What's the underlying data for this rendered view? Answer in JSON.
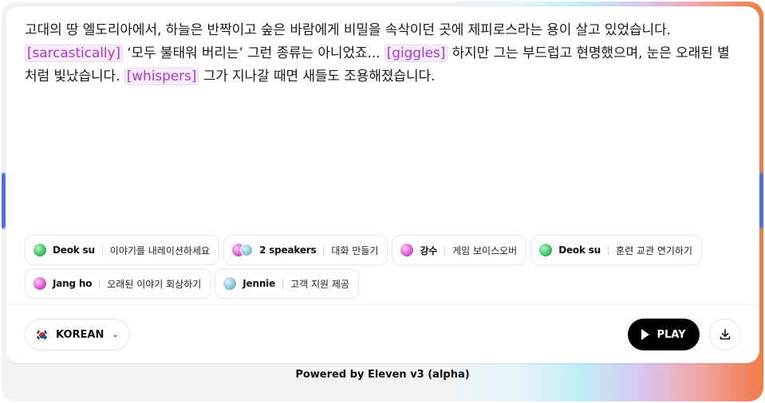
{
  "editor": {
    "segments": [
      {
        "type": "text",
        "value": "고대의 땅 엘도리아에서, 하늘은 반짝이고 숲은 바람에게 비밀을 속삭이던 곳에 제피로스라는 용이 살고 있었습니다. "
      },
      {
        "type": "tag",
        "value": "[sarcastically]"
      },
      {
        "type": "text",
        "value": " ‘모두 불태워 버리는’ 그런 종류는 아니었죠... "
      },
      {
        "type": "tag",
        "value": "[giggles]"
      },
      {
        "type": "text",
        "value": " 하지만 그는 부드럽고 현명했으며, 눈은 오래된 별처럼 빛났습니다. "
      },
      {
        "type": "tag",
        "value": "[whispers]"
      },
      {
        "type": "text",
        "value": " 그가 지나갈 때면 새들도 조용해졌습니다."
      }
    ]
  },
  "chips": [
    [
      {
        "name": "Deok su",
        "action": "이야기를 내레이션하세요",
        "avatars": [
          "green"
        ]
      },
      {
        "name": "2 speakers",
        "action": "대화 만들기",
        "avatars": [
          "pink",
          "blue"
        ]
      },
      {
        "name": "강수",
        "action": "게임 보이스오버",
        "avatars": [
          "pink"
        ]
      },
      {
        "name": "Deok su",
        "action": "훈련 교관 연기하기",
        "avatars": [
          "green"
        ]
      }
    ],
    [
      {
        "name": "Jang ho",
        "action": "오래된 이야기 회상하기",
        "avatars": [
          "pink"
        ]
      },
      {
        "name": "Jennie",
        "action": "고객 지원 제공",
        "avatars": [
          "blue"
        ]
      }
    ]
  ],
  "language": {
    "label": "KOREAN",
    "flag_icon": "korea-flag-icon"
  },
  "controls": {
    "play_label": "PLAY",
    "download_icon": "download-icon"
  },
  "footer": {
    "text": "Powered by Eleven v3 (alpha)"
  },
  "colors": {
    "tag": "#a93bcb",
    "play_bg": "#000000"
  }
}
